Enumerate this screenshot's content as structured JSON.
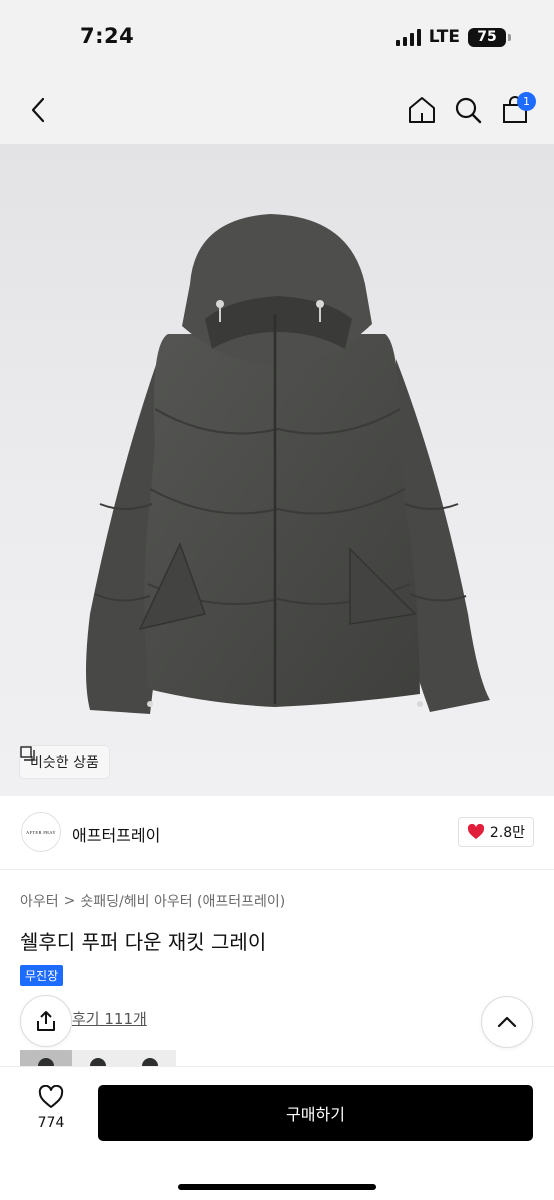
{
  "status_bar": {
    "time": "7:24",
    "network": "LTE",
    "battery": "75"
  },
  "header": {
    "cart_count": "1",
    "icons": [
      "back-icon",
      "home-icon",
      "search-icon",
      "cart-icon"
    ]
  },
  "product_image": {
    "similar_button_label": "비슷한 상품",
    "similar_icon": "copy-icon"
  },
  "brand": {
    "logo_text": "AFTER PRAY",
    "name": "애프터프레이",
    "likes": "2.8만",
    "like_icon": "heart-filled-icon"
  },
  "product": {
    "breadcrumb": [
      "아우터",
      "숏패딩/헤비 아우터 (애프터프레이)"
    ],
    "title": "쉘후디 푸퍼 다운 재킷 그레이",
    "badge": "무진장",
    "reviews": "후기 111개"
  },
  "swatches": [
    {
      "color": "#2e2f2f",
      "selected": true
    },
    {
      "color": "#2e2f2f",
      "selected": false
    },
    {
      "color": "#2e2f2f",
      "selected": false
    }
  ],
  "bottom_bar": {
    "like_count": "774",
    "buy_label": "구매하기"
  },
  "colors": {
    "accent": "#1e6bff",
    "heart": "#e0203a",
    "jacket": "#4a4b48"
  }
}
